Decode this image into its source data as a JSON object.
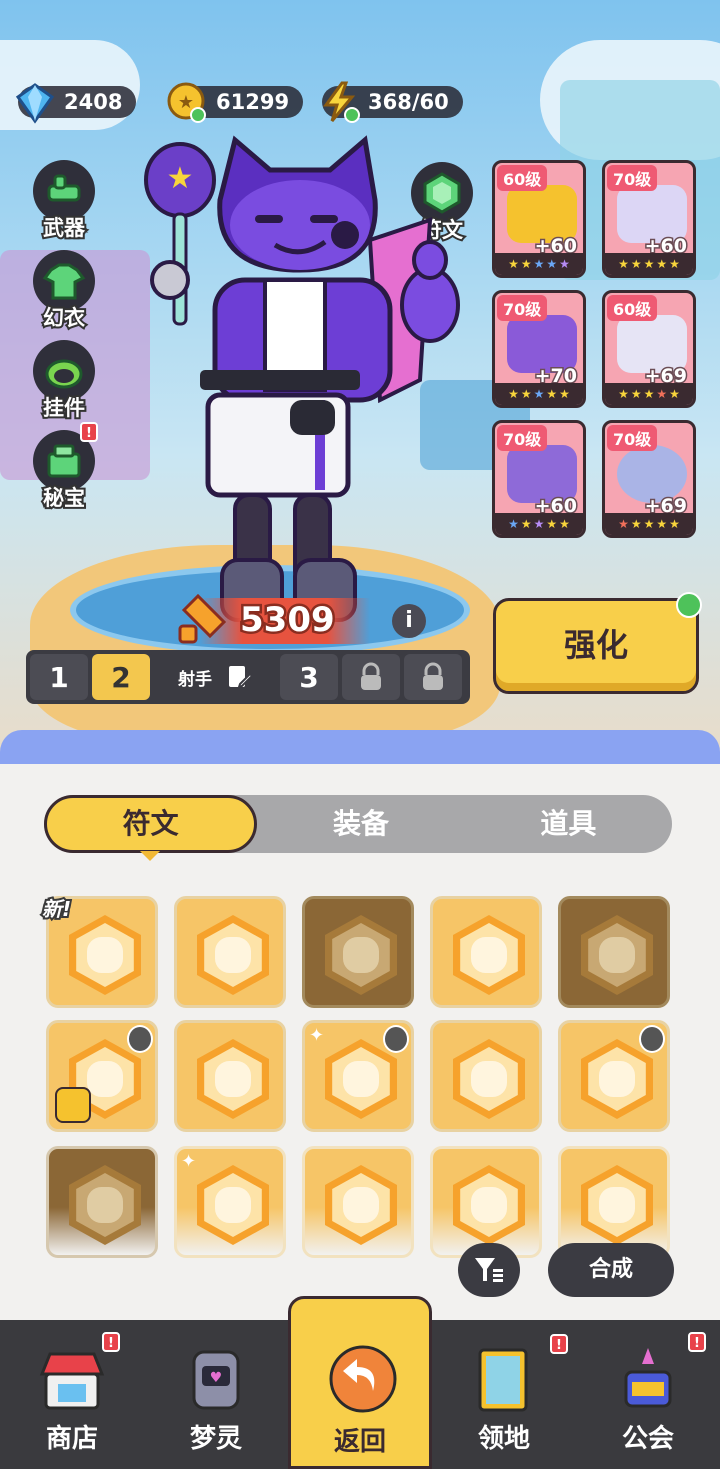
{
  "currencies": [
    {
      "name": "gem-icon",
      "value": "2408",
      "color": "#4fb5f0"
    },
    {
      "name": "coin-icon",
      "value": "61299",
      "color": "#f5c22e"
    },
    {
      "name": "energy-icon",
      "value": "368/60",
      "color": "#f8d53c"
    }
  ],
  "side_menu": {
    "weapon": "武器",
    "outfit": "幻衣",
    "pendant": "挂件",
    "treasure": "秘宝",
    "rune": "符文"
  },
  "equipment": [
    {
      "level": "60级",
      "bonus": "+60"
    },
    {
      "level": "70级",
      "bonus": "+60"
    },
    {
      "level": "70级",
      "bonus": "+70"
    },
    {
      "level": "60级",
      "bonus": "+69"
    },
    {
      "level": "70级",
      "bonus": "+60"
    },
    {
      "level": "70级",
      "bonus": "+69"
    }
  ],
  "power": "5309",
  "info_label": "i",
  "loadout": {
    "slot1": "1",
    "slot2": "2",
    "name": "射手",
    "slot3": "3"
  },
  "strengthen_label": "强化",
  "tabs": [
    "符文",
    "装备",
    "道具"
  ],
  "new_label": "新!",
  "compose_label": "合成",
  "red_dot": "!",
  "nav": [
    "商店",
    "梦灵",
    "返回",
    "领地",
    "公会"
  ],
  "colors": {
    "accent": "#f8cf4a",
    "panel_header": "#8aa3f2",
    "equipment_card": "#f6a5b2",
    "nav_bg": "#3a3a3e"
  }
}
